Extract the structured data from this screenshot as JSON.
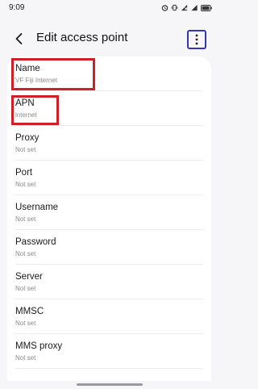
{
  "status": {
    "time": "9:09",
    "battery_level": 0.95
  },
  "header": {
    "title": "Edit access point"
  },
  "fields": [
    {
      "label": "Name",
      "value": "VF Fiji Internet"
    },
    {
      "label": "APN",
      "value": "internet"
    },
    {
      "label": "Proxy",
      "value": "Not set"
    },
    {
      "label": "Port",
      "value": "Not set"
    },
    {
      "label": "Username",
      "value": "Not set"
    },
    {
      "label": "Password",
      "value": "Not set"
    },
    {
      "label": "Server",
      "value": "Not set"
    },
    {
      "label": "MMSC",
      "value": "Not set"
    },
    {
      "label": "MMS proxy",
      "value": "Not set"
    }
  ],
  "colors": {
    "highlight_red": "#d11f27",
    "menu_box_blue": "#3436b8"
  }
}
